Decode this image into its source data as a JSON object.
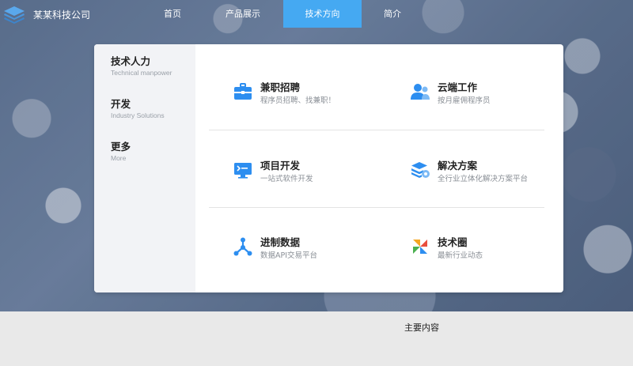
{
  "header": {
    "company_name": "某某科技公司",
    "nav": [
      {
        "label": "首页"
      },
      {
        "label": "产品展示"
      },
      {
        "label": "技术方向",
        "active": true
      },
      {
        "label": "简介"
      }
    ],
    "active_color": "#45a9f2"
  },
  "panel": {
    "categories": [
      {
        "title": "技术人力",
        "subtitle": "Technical manpower"
      },
      {
        "title": "开发",
        "subtitle": "Industry Solutions"
      },
      {
        "title": "更多",
        "subtitle": "More"
      }
    ],
    "items": [
      {
        "title": "兼职招聘",
        "subtitle": "程序员招聘、找兼职！",
        "icon": "briefcase-icon"
      },
      {
        "title": "云端工作",
        "subtitle": "按月雇佣程序员",
        "icon": "users-icon"
      },
      {
        "title": "项目开发",
        "subtitle": "一站式软件开发",
        "icon": "monitor-icon"
      },
      {
        "title": "解决方案",
        "subtitle": "全行业立体化解决方案平台",
        "icon": "stack-icon"
      },
      {
        "title": "进制数据",
        "subtitle": "数据API交易平台",
        "icon": "nodes-icon"
      },
      {
        "title": "技术圈",
        "subtitle": "最新行业动态",
        "icon": "pinwheel-icon"
      }
    ]
  },
  "footer": {
    "main_content_label": "主要内容"
  }
}
